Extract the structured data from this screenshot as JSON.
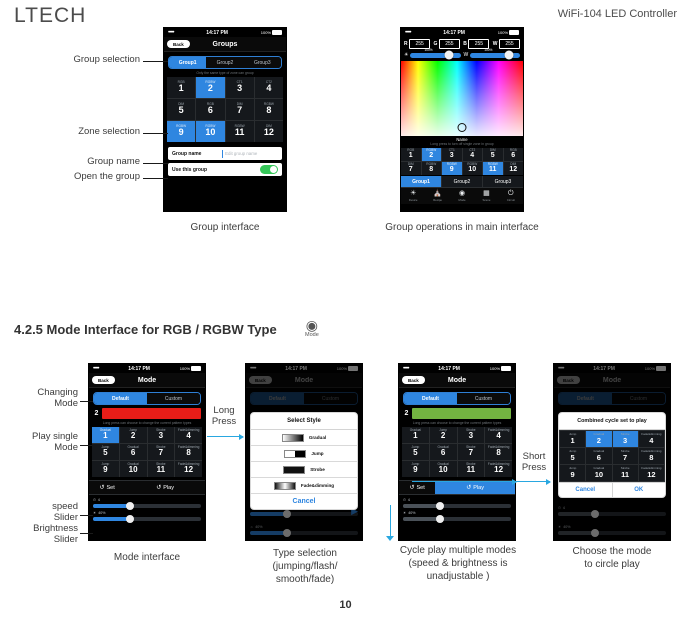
{
  "header": {
    "logo": "LTECH",
    "doc_title": "WiFi-104 LED Controller"
  },
  "page_number": "10",
  "section": {
    "heading": "4.2.5 Mode Interface for RGB / RGBW Type",
    "badge_icon": "mode-icon",
    "badge_label": "Mode"
  },
  "status_bar": {
    "signal": "•••••",
    "wifi_icon": "wifi-icon",
    "time": "14:17 PM",
    "battery": "100%"
  },
  "annotations": {
    "group_selection": "Group selection",
    "zone_selection": "Zone selection",
    "group_name": "Group name",
    "open_the_group": "Open the group",
    "changing_mode": "Changing\nMode",
    "changing_mode_l1": "Changing",
    "changing_mode_l2": "Mode",
    "play_single_mode_l1": "Play single",
    "play_single_mode_l2": "Mode",
    "speed_slider_l1": "speed",
    "speed_slider_l2": "Slider",
    "brightness_slider_l1": "Brightness",
    "brightness_slider_l2": "Slider",
    "long_press_l1": "Long",
    "long_press_l2": "Press",
    "short_press_l1": "Short",
    "short_press_l2": "Press"
  },
  "captions": {
    "group_interface": "Group interface",
    "group_operations": "Group operations in main interface",
    "mode_interface": "Mode interface",
    "type_selection_l1": "Type selection",
    "type_selection_l2": "(jumping/flash/",
    "type_selection_l3": "smooth/fade)",
    "cycle_play_l1": "Cycle play multiple modes",
    "cycle_play_l2": "(speed & brightness is",
    "cycle_play_l3": "unadjustable )",
    "choose_mode_l1": "Choose the mode",
    "choose_mode_l2": "to circle play"
  },
  "phone_group": {
    "nav": {
      "back": "Back",
      "title": "Groups"
    },
    "groups": [
      {
        "label": "Group1",
        "selected": true
      },
      {
        "label": "Group2",
        "selected": false
      },
      {
        "label": "Group3",
        "selected": false
      }
    ],
    "hint": "Only the same type of zone can group",
    "zones": [
      {
        "type": "RGB",
        "num": "1",
        "selected": false
      },
      {
        "type": "RGBW",
        "num": "2",
        "selected": true
      },
      {
        "type": "CT1",
        "num": "3",
        "selected": false
      },
      {
        "type": "CT2",
        "num": "4",
        "selected": false
      },
      {
        "type": "DIM",
        "num": "5",
        "selected": false
      },
      {
        "type": "RGB",
        "num": "6",
        "selected": false
      },
      {
        "type": "DIM",
        "num": "7",
        "selected": false
      },
      {
        "type": "RGBW",
        "num": "8",
        "selected": false
      },
      {
        "type": "RGBW",
        "num": "9",
        "selected": true
      },
      {
        "type": "RGBW",
        "num": "10",
        "selected": true
      },
      {
        "type": "RGBW",
        "num": "11",
        "selected": false
      },
      {
        "type": "DIM",
        "num": "12",
        "selected": false
      }
    ],
    "group_name_label": "Group name",
    "group_name_placeholder": "Edit group name",
    "use_group_label": "Use this group",
    "use_group_on": true
  },
  "phone_main": {
    "channels": [
      {
        "key": "R",
        "value": "255"
      },
      {
        "key": "G",
        "value": "255"
      },
      {
        "key": "B",
        "value": "255"
      },
      {
        "key": "W",
        "value": "255"
      }
    ],
    "sliders": [
      {
        "icon": "brightness-icon",
        "label": "",
        "percent": "100%"
      },
      {
        "icon": "white-icon",
        "key": "W",
        "percent": "100%"
      }
    ],
    "name_label": "Name",
    "name_hint": "Long press to turn off single zone in group",
    "zones": [
      {
        "type": "RGB",
        "num": "1",
        "selected": false
      },
      {
        "type": "RGBW",
        "num": "2",
        "selected": true
      },
      {
        "type": "CT1",
        "num": "3",
        "selected": false
      },
      {
        "type": "CT2",
        "num": "4",
        "selected": false
      },
      {
        "type": "DIM",
        "num": "5",
        "selected": false
      },
      {
        "type": "RGB",
        "num": "6",
        "selected": false
      },
      {
        "type": "DIM",
        "num": "7",
        "selected": false
      },
      {
        "type": "RGBW",
        "num": "8",
        "selected": false
      },
      {
        "type": "RGBW",
        "num": "9",
        "selected": true
      },
      {
        "type": "RGBW",
        "num": "10",
        "selected": false
      },
      {
        "type": "RGBW",
        "num": "11",
        "selected": true
      },
      {
        "type": "DIM",
        "num": "12",
        "selected": false
      }
    ],
    "groups": [
      {
        "label": "Group1",
        "selected": true
      },
      {
        "label": "Group2",
        "selected": false
      },
      {
        "label": "Group3",
        "selected": false
      }
    ],
    "tabs": [
      {
        "icon": "device-icon",
        "label": "Device"
      },
      {
        "icon": "recipe-icon",
        "label": "Recipe"
      },
      {
        "icon": "mode-icon",
        "label": "Mode"
      },
      {
        "icon": "scene-icon",
        "label": "Scene"
      },
      {
        "icon": "circuit-icon",
        "label": "Circuit"
      }
    ]
  },
  "phone_mode": {
    "nav": {
      "back": "Back",
      "title": "Mode"
    },
    "tabs": [
      {
        "label": "Default",
        "selected": true
      },
      {
        "label": "Custom",
        "selected": false
      }
    ],
    "pattern_index": "2",
    "pattern_color": "#e81d18",
    "hint": "Long press can choose to change the current pattern types",
    "modes": [
      {
        "style": "Gradual",
        "num": "1",
        "selected": true
      },
      {
        "style": "Jump",
        "num": "2",
        "selected": false
      },
      {
        "style": "Strobe",
        "num": "3",
        "selected": false
      },
      {
        "style": "Fade&dimming",
        "num": "4",
        "selected": false
      },
      {
        "style": "Jump",
        "num": "5",
        "selected": false
      },
      {
        "style": "Gradual",
        "num": "6",
        "selected": false
      },
      {
        "style": "Strobe",
        "num": "7",
        "selected": false
      },
      {
        "style": "Fade&dimming",
        "num": "8",
        "selected": false
      },
      {
        "style": "Jump",
        "num": "9",
        "selected": false
      },
      {
        "style": "Gradual",
        "num": "10",
        "selected": false
      },
      {
        "style": "Strobe",
        "num": "11",
        "selected": false
      },
      {
        "style": "Fade&dimming",
        "num": "12",
        "selected": false
      }
    ],
    "set_label": "Set",
    "play_label": "Play",
    "play_active": false,
    "speed": {
      "icon": "clock-icon",
      "value": "4",
      "percent": 34
    },
    "brightness": {
      "icon": "brightness-icon",
      "value": "40%",
      "percent": 34
    }
  },
  "phone_style_dialog": {
    "nav": {
      "back": "Back",
      "title": "Mode"
    },
    "tabs": [
      {
        "label": "Default",
        "selected": true
      },
      {
        "label": "Custom",
        "selected": false
      }
    ],
    "dialog_title": "Select Style",
    "items": [
      {
        "label": "Gradual",
        "swatch": "gradient"
      },
      {
        "label": "Jump",
        "swatch": "half"
      },
      {
        "label": "Strobe",
        "swatch": "solid"
      },
      {
        "label": "Fade&dimming",
        "swatch": "fade"
      }
    ],
    "cancel": "Cancel",
    "slider_top": {
      "icon": "brightness-icon",
      "value": "40%"
    },
    "slider_bottom": {
      "icon": "white-icon",
      "value": "40%"
    }
  },
  "phone_cycle": {
    "nav": {
      "back": "Back",
      "title": "Mode"
    },
    "tabs": [
      {
        "label": "Default",
        "selected": true
      },
      {
        "label": "Custom",
        "selected": false
      }
    ],
    "pattern_index": "2",
    "pattern_color": "#73b441",
    "hint": "Long press can choose to change the current pattern types",
    "modes": [
      {
        "style": "Gradual",
        "num": "1",
        "selected": false
      },
      {
        "style": "Jump",
        "num": "2",
        "selected": false
      },
      {
        "style": "Strobe",
        "num": "3",
        "selected": false
      },
      {
        "style": "Fade&dimming",
        "num": "4",
        "selected": false
      },
      {
        "style": "Jump",
        "num": "5",
        "selected": false
      },
      {
        "style": "Gradual",
        "num": "6",
        "selected": false
      },
      {
        "style": "Strobe",
        "num": "7",
        "selected": false
      },
      {
        "style": "Fade&dimming",
        "num": "8",
        "selected": false
      },
      {
        "style": "Jump",
        "num": "9",
        "selected": false
      },
      {
        "style": "Gradual",
        "num": "10",
        "selected": false
      },
      {
        "style": "Strobe",
        "num": "11",
        "selected": false
      },
      {
        "style": "Fade&dimming",
        "num": "12",
        "selected": false
      }
    ],
    "set_label": "Set",
    "play_label": "Play",
    "play_active": true,
    "speed": {
      "icon": "clock-icon",
      "value": "4",
      "percent": 34
    },
    "brightness": {
      "icon": "brightness-icon",
      "value": "40%",
      "percent": 34
    }
  },
  "phone_combined": {
    "nav": {
      "back": "Back",
      "title": "Mode"
    },
    "tabs": [
      {
        "label": "Default",
        "selected": true
      },
      {
        "label": "Custom",
        "selected": false
      }
    ],
    "dialog_title": "Combined cycle set to play",
    "modes": [
      {
        "style": "Jump",
        "num": "1",
        "selected": false
      },
      {
        "style": "Gradual",
        "num": "2",
        "selected": true
      },
      {
        "style": "Strobe",
        "num": "3",
        "selected": true
      },
      {
        "style": "Fade&dimming",
        "num": "4",
        "selected": false
      },
      {
        "style": "Jump",
        "num": "5",
        "selected": false
      },
      {
        "style": "Gradual",
        "num": "6",
        "selected": false
      },
      {
        "style": "Strobe",
        "num": "7",
        "selected": false
      },
      {
        "style": "Fade&dimming",
        "num": "8",
        "selected": false
      },
      {
        "style": "Jump",
        "num": "9",
        "selected": false
      },
      {
        "style": "Gradual",
        "num": "10",
        "selected": false
      },
      {
        "style": "Strobe",
        "num": "11",
        "selected": false
      },
      {
        "style": "Fade&dimming",
        "num": "12",
        "selected": false
      }
    ],
    "cancel": "Cancel",
    "ok": "OK",
    "speed": {
      "icon": "clock-icon",
      "value": "4",
      "percent": 34
    },
    "brightness": {
      "icon": "brightness-icon",
      "value": "40%",
      "percent": 34
    }
  },
  "colors": {
    "accent": "#2f86e0",
    "toggle_on": "#35c759",
    "arrow": "#29a7e0",
    "pattern_red": "#e81d18",
    "pattern_green": "#73b441"
  }
}
